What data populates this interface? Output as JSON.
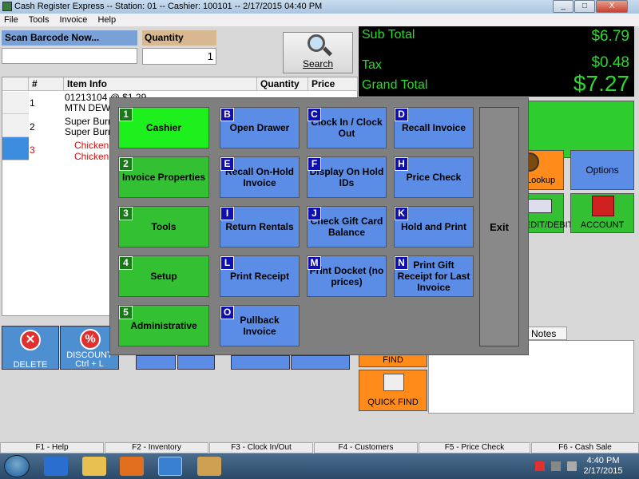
{
  "window": {
    "title": "Cash Register Express -- Station: 01 -- Cashier: 100101 -- 2/17/2015 04:40 PM",
    "minimize": "_",
    "maximize": "□",
    "close": "X"
  },
  "menu": [
    "File",
    "Tools",
    "Invoice",
    "Help"
  ],
  "scan": {
    "label": "Scan Barcode Now...",
    "value": ""
  },
  "quantity": {
    "label": "Quantity",
    "value": "1"
  },
  "search": {
    "label": "Search"
  },
  "totals": {
    "subtotal_label": "Sub Total",
    "subtotal": "$6.79",
    "tax_label": "Tax",
    "tax": "$0.48",
    "grand_label": "Grand Total",
    "grand": "$7.27"
  },
  "grid": {
    "headers": [
      "#",
      "Item Info",
      "Quantity",
      "Price"
    ],
    "rows": [
      {
        "num": "1",
        "line1": "01213104 @ $1.29",
        "line2": "MTN DEW",
        "color": "#000000"
      },
      {
        "num": "2",
        "line1": "Super Burr",
        "line2": "Super Burr",
        "color": "#000000"
      },
      {
        "num": "3",
        "line1": "Chicken",
        "line2": "Chicken",
        "color": "#d01010"
      }
    ]
  },
  "right": {
    "lookup": "Lookup",
    "options": "Options",
    "credit": "CREDIT/DEBIT",
    "account": "ACCOUNT",
    "notes_tab": "er Notes",
    "find": "FIND",
    "quick_find": "QUICK FIND"
  },
  "bottom": {
    "delete": "DELETE",
    "discount": "DISCOUNT",
    "discount_key": "Ctrl + L"
  },
  "fkeys": [
    "F1 - Help",
    "F2 - Inventory",
    "F3 - Clock In/Out",
    "F4 - Customers",
    "F5 - Price Check",
    "F6 - Cash Sale"
  ],
  "menu_overlay": {
    "buttons": [
      {
        "key": "1",
        "label": "Cashier"
      },
      {
        "key": "2",
        "label": "Invoice Properties"
      },
      {
        "key": "3",
        "label": "Tools"
      },
      {
        "key": "4",
        "label": "Setup"
      },
      {
        "key": "5",
        "label": "Administrative"
      },
      {
        "key": "B",
        "label": "Open Drawer"
      },
      {
        "key": "E",
        "label": "Recall On-Hold Invoice"
      },
      {
        "key": "I",
        "label": "Return Rentals"
      },
      {
        "key": "L",
        "label": "Print Receipt"
      },
      {
        "key": "O",
        "label": "Pullback Invoice"
      },
      {
        "key": "C",
        "label": "Clock In / Clock Out"
      },
      {
        "key": "F",
        "label": "Display On Hold IDs"
      },
      {
        "key": "J",
        "label": "Check Gift Card Balance"
      },
      {
        "key": "M",
        "label": "Print Docket (no prices)"
      },
      {
        "key": "D",
        "label": "Recall Invoice"
      },
      {
        "key": "H",
        "label": "Price Check"
      },
      {
        "key": "K",
        "label": "Hold and Print"
      },
      {
        "key": "N",
        "label": "Print Gift Receipt for Last Invoice"
      }
    ],
    "exit": "Exit"
  },
  "taskbar": {
    "time": "4:40 PM",
    "date": "2/17/2015"
  },
  "colors": {
    "total_green": "#2dd82d",
    "button_green": "#33c033",
    "button_blue": "#5b8de6",
    "badge_blue": "#1010b0"
  }
}
